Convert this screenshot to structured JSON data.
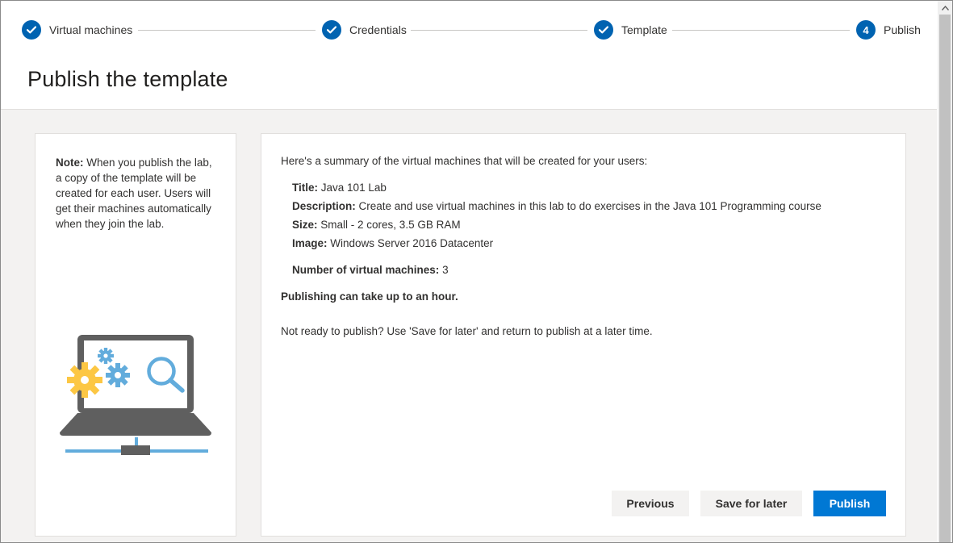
{
  "wizard": {
    "steps": [
      {
        "label": "Virtual machines",
        "state": "completed"
      },
      {
        "label": "Credentials",
        "state": "completed"
      },
      {
        "label": "Template",
        "state": "completed"
      },
      {
        "label": "Publish",
        "state": "current",
        "number": "4"
      }
    ]
  },
  "header": {
    "title": "Publish the template"
  },
  "note": {
    "label": "Note:",
    "text": "When you publish the lab, a copy of the template will be created for each user. Users will get their machines automatically when they join the lab."
  },
  "summary": {
    "intro": "Here's a summary of the virtual machines that will be created for your users:",
    "title_label": "Title:",
    "title_value": "Java 101 Lab",
    "description_label": "Description:",
    "description_value": "Create and use virtual machines in this lab to do exercises in the Java 101 Programming course",
    "size_label": "Size:",
    "size_value": "Small - 2 cores, 3.5 GB RAM",
    "image_label": "Image:",
    "image_value": "Windows Server 2016 Datacenter",
    "vm_count_label": "Number of virtual machines:",
    "vm_count_value": "3",
    "publishing_note": "Publishing can take up to an hour.",
    "later_note": "Not ready to publish? Use 'Save for later' and return to publish at a later time."
  },
  "buttons": {
    "previous": "Previous",
    "save_for_later": "Save for later",
    "publish": "Publish"
  },
  "colors": {
    "accent": "#0063b1",
    "primary_button": "#0078d4",
    "illustration_gear_yellow": "#fcc744",
    "illustration_blue": "#62acdc",
    "illustration_gray": "#5f5f5f"
  },
  "icons": {
    "step_completed": "checkmark-icon",
    "illustration": "laptop-with-gears-and-magnifier"
  }
}
